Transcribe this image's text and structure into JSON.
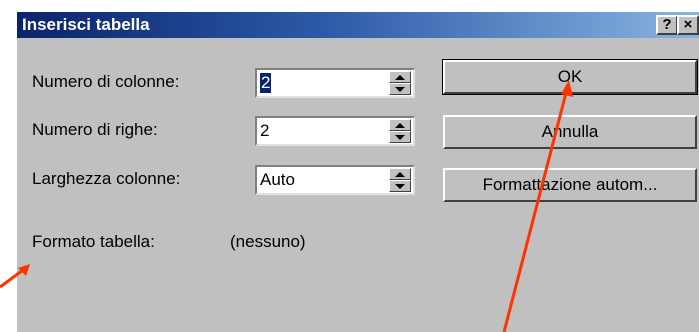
{
  "dialog": {
    "title": "Inserisci tabella",
    "help_button": "?",
    "close_button": "×"
  },
  "fields": {
    "columns": {
      "label": "Numero di colonne:",
      "value": "2"
    },
    "rows": {
      "label": "Numero di righe:",
      "value": "2"
    },
    "width": {
      "label": "Larghezza colonne:",
      "value": "Auto"
    }
  },
  "format": {
    "label": "Formato tabella:",
    "value": "(nessuno)"
  },
  "buttons": {
    "ok": "OK",
    "cancel": "Annulla",
    "autoformat": "Formattazione autom..."
  },
  "colors": {
    "arrow": "#ff3300",
    "title_bar": "#0a246a",
    "dialog_bg": "#c0c0c0"
  }
}
